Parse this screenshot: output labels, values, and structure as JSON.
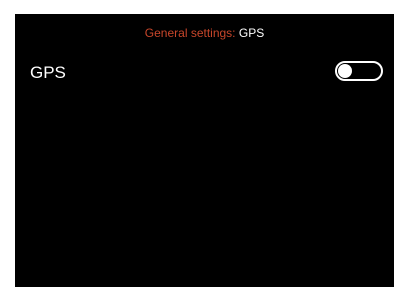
{
  "header": {
    "prefix": "General settings:",
    "current": "GPS"
  },
  "settings": [
    {
      "label": "GPS",
      "control": "toggle",
      "enabled": false
    }
  ],
  "colors": {
    "background": "#000000",
    "accent": "#c8462a",
    "text": "#ffffff"
  }
}
